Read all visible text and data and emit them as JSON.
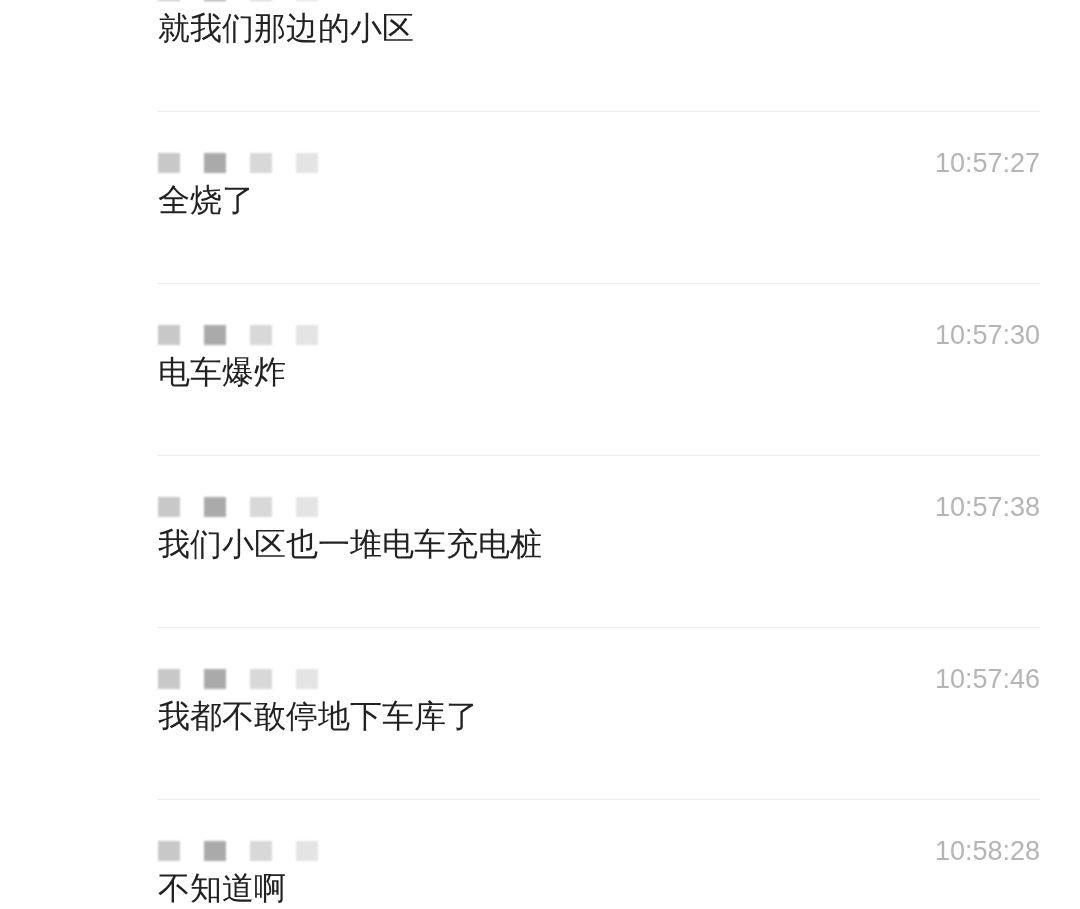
{
  "messages": [
    {
      "text": "就我们那边的小区"
    },
    {
      "time": "10:57:27",
      "text": "全烧了"
    },
    {
      "time": "10:57:30",
      "text": "电车爆炸"
    },
    {
      "time": "10:57:38",
      "text": "我们小区也一堆电车充电桩"
    },
    {
      "time": "10:57:46",
      "text": "我都不敢停地下车库了"
    },
    {
      "time": "10:58:28",
      "text": "不知道啊"
    }
  ]
}
